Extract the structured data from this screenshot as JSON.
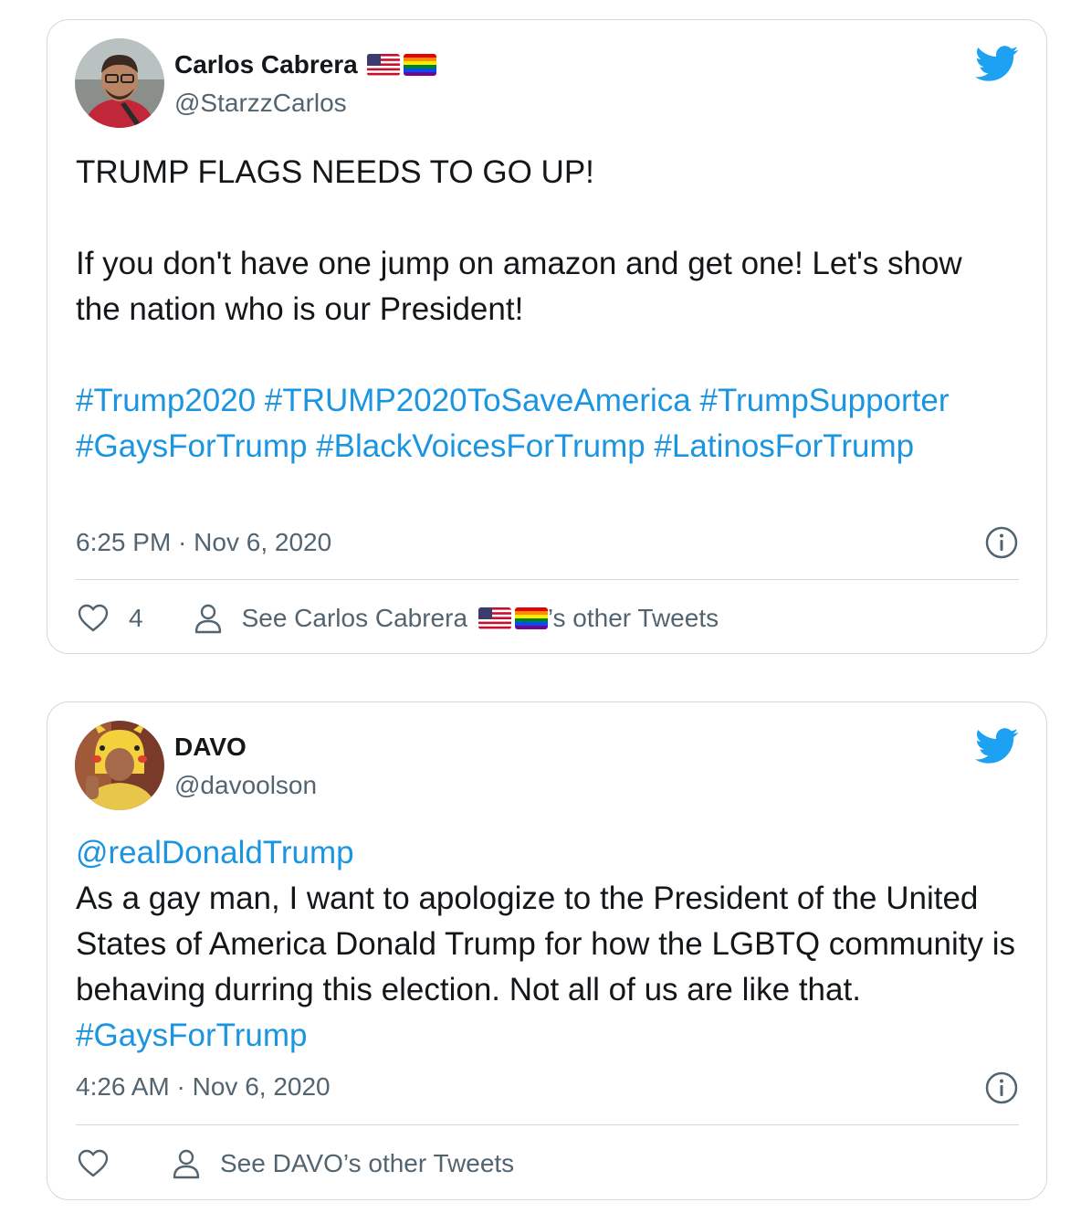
{
  "tweets": [
    {
      "author_name": "Carlos Cabrera",
      "author_emoji": [
        "us-flag-emoji",
        "rainbow-flag-emoji"
      ],
      "handle": "@StarzzCarlos",
      "lines": {
        "p1": "TRUMP FLAGS NEEDS TO GO UP!",
        "p2": "If you don't have one jump on amazon and get one! Let's show the nation who is our President!"
      },
      "hashtags": [
        "#Trump2020",
        "#TRUMP2020ToSaveAmerica",
        "#TrumpSupporter",
        "#GaysForTrump",
        "#BlackVoicesForTrump",
        "#LatinosForTrump"
      ],
      "time": "6:25 PM",
      "date": "Nov 6, 2020",
      "likes": "4",
      "see_other_prefix": "See Carlos Cabrera ",
      "see_other_suffix": "’s other Tweets"
    },
    {
      "author_name": "DAVO",
      "handle": "@davoolson",
      "mention": "@realDonaldTrump",
      "text": "As a gay man, I want to apologize to the President of the United States of America Donald Trump for how the LGBTQ community is behaving durring this election. Not all of us are like that. ",
      "hashtag": "#GaysForTrump",
      "time": "4:26 AM",
      "date": "Nov 6, 2020",
      "likes": "",
      "see_other": "See DAVO’s other Tweets"
    }
  ],
  "separator": " · ",
  "colors": {
    "twitter_blue": "#1da1f2",
    "link_blue": "#1b95e0",
    "secondary_text": "#536471",
    "border": "#cfd9de"
  }
}
